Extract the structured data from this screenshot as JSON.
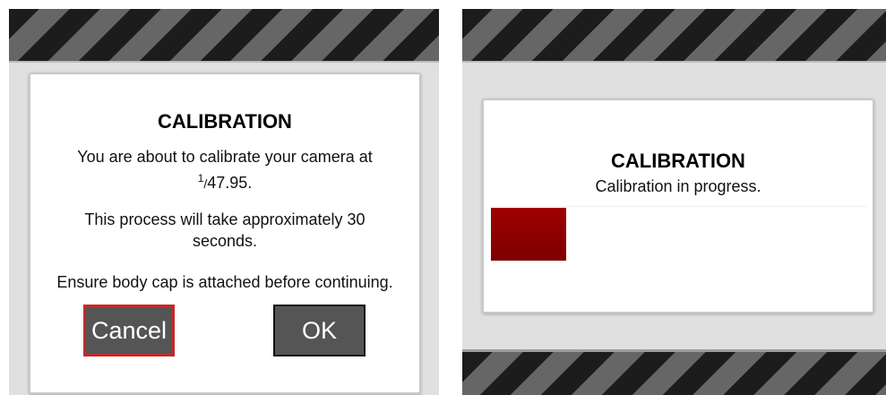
{
  "left_screen": {
    "dialog": {
      "title": "CALIBRATION",
      "message_line1": "You are about to calibrate your camera at",
      "frame_rate_numerator": "1",
      "frame_rate_denominator": "47.95.",
      "message_line2a": "This process will take approximately 30",
      "message_line2b": "seconds.",
      "message_line3": "Ensure body cap is attached before continuing.",
      "cancel_label": "Cancel",
      "ok_label": "OK"
    }
  },
  "right_screen": {
    "dialog": {
      "title": "CALIBRATION",
      "status": "Calibration in progress.",
      "progress_fraction": 0.2
    }
  },
  "colors": {
    "hazard_dark": "#1c1c1c",
    "hazard_light": "#666666",
    "cancel_border": "#c62828",
    "progress_fill": "#9a0000"
  }
}
